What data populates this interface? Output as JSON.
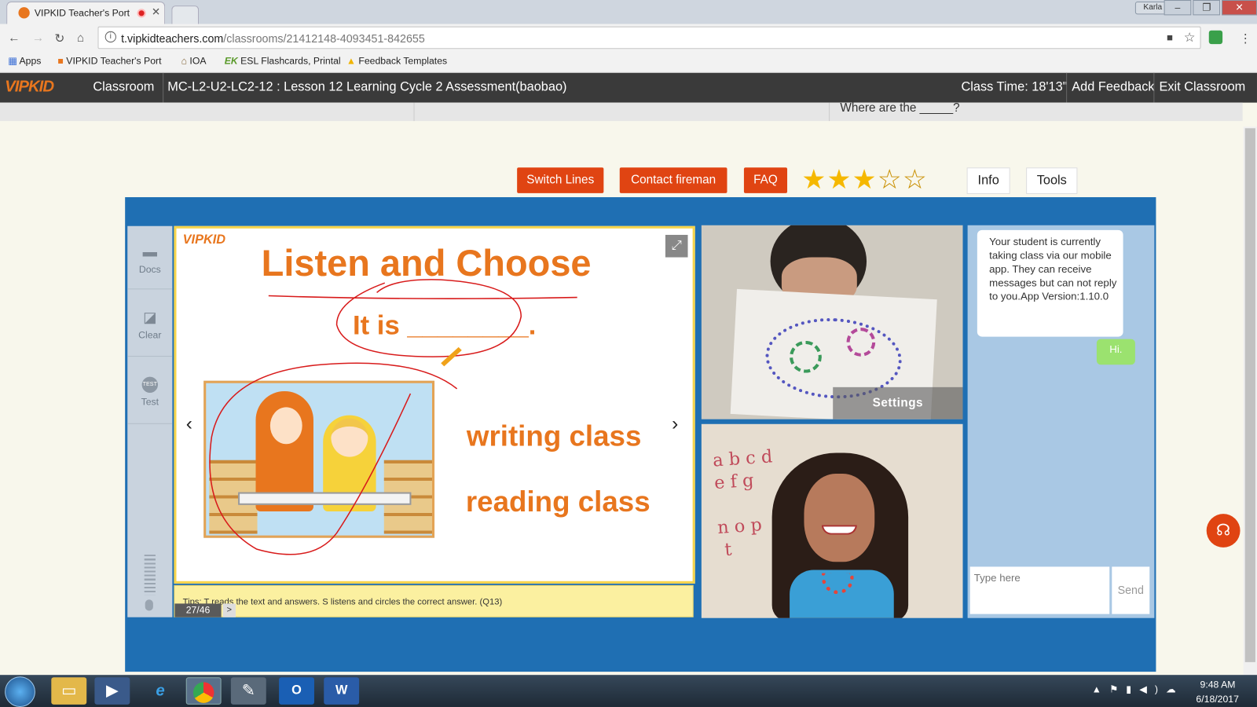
{
  "browser": {
    "tab_title": "VIPKID Teacher's Port",
    "url_host": "t.vipkidteachers.com",
    "url_path": "/classrooms/21412148-4093451-842655",
    "profile_name": "Karla"
  },
  "bookmarks": [
    {
      "icon": "apps-grid-icon",
      "label": "Apps"
    },
    {
      "icon": "vipkid-bookmark-icon",
      "label": "VIPKID Teacher's Port"
    },
    {
      "icon": "ioa-bookmark-icon",
      "label": "IOA"
    },
    {
      "icon": "ek-bookmark-icon",
      "label": "ESL Flashcards, Printal"
    },
    {
      "icon": "drive-bookmark-icon",
      "label": "Feedback Templates"
    }
  ],
  "header": {
    "logo": "VIPKID",
    "classroom_label": "Classroom",
    "lesson_title": "MC-L2-U2-LC2-12 : Lesson 12 Learning Cycle 2 Assessment(baobao)",
    "class_time": "Class Time: 18'13\"",
    "add_feedback": "Add Feedback",
    "exit_classroom": "Exit Classroom",
    "peek_text": "Where are the _____?"
  },
  "actions": {
    "switch_lines": "Switch Lines",
    "contact_fireman": "Contact fireman",
    "faq": "FAQ",
    "rating": 3,
    "rating_max": 5,
    "info": "Info",
    "tools": "Tools"
  },
  "sidebar_tools": [
    {
      "icon": "folder-icon",
      "label": "Docs"
    },
    {
      "icon": "eraser-icon",
      "label": "Clear"
    },
    {
      "icon": "test-icon",
      "label": "Test"
    }
  ],
  "slide": {
    "logo": "VIPKID",
    "title": "Listen and Choose",
    "prompt": "It is ________.",
    "option1": "writing class",
    "option2": "reading class",
    "tips": "Tips: T reads the text and answers. S listens and circles the correct answer. (Q13)",
    "page": "27/46",
    "next_page": ">"
  },
  "video": {
    "settings_label": "Settings"
  },
  "chat": {
    "system_message": "Your student is currently taking class via our mobile app. They can receive messages but can not reply to you.App Version:1.10.0",
    "sent_message": "Hi.",
    "input_placeholder": "Type here",
    "send_label": "Send"
  },
  "taskbar": {
    "time": "9:48 AM",
    "date": "6/18/2017"
  },
  "colors": {
    "accent_orange": "#e04412",
    "panel_blue": "#1f6fb3",
    "slide_text_orange": "#e8761e",
    "star_gold": "#f5b800"
  }
}
